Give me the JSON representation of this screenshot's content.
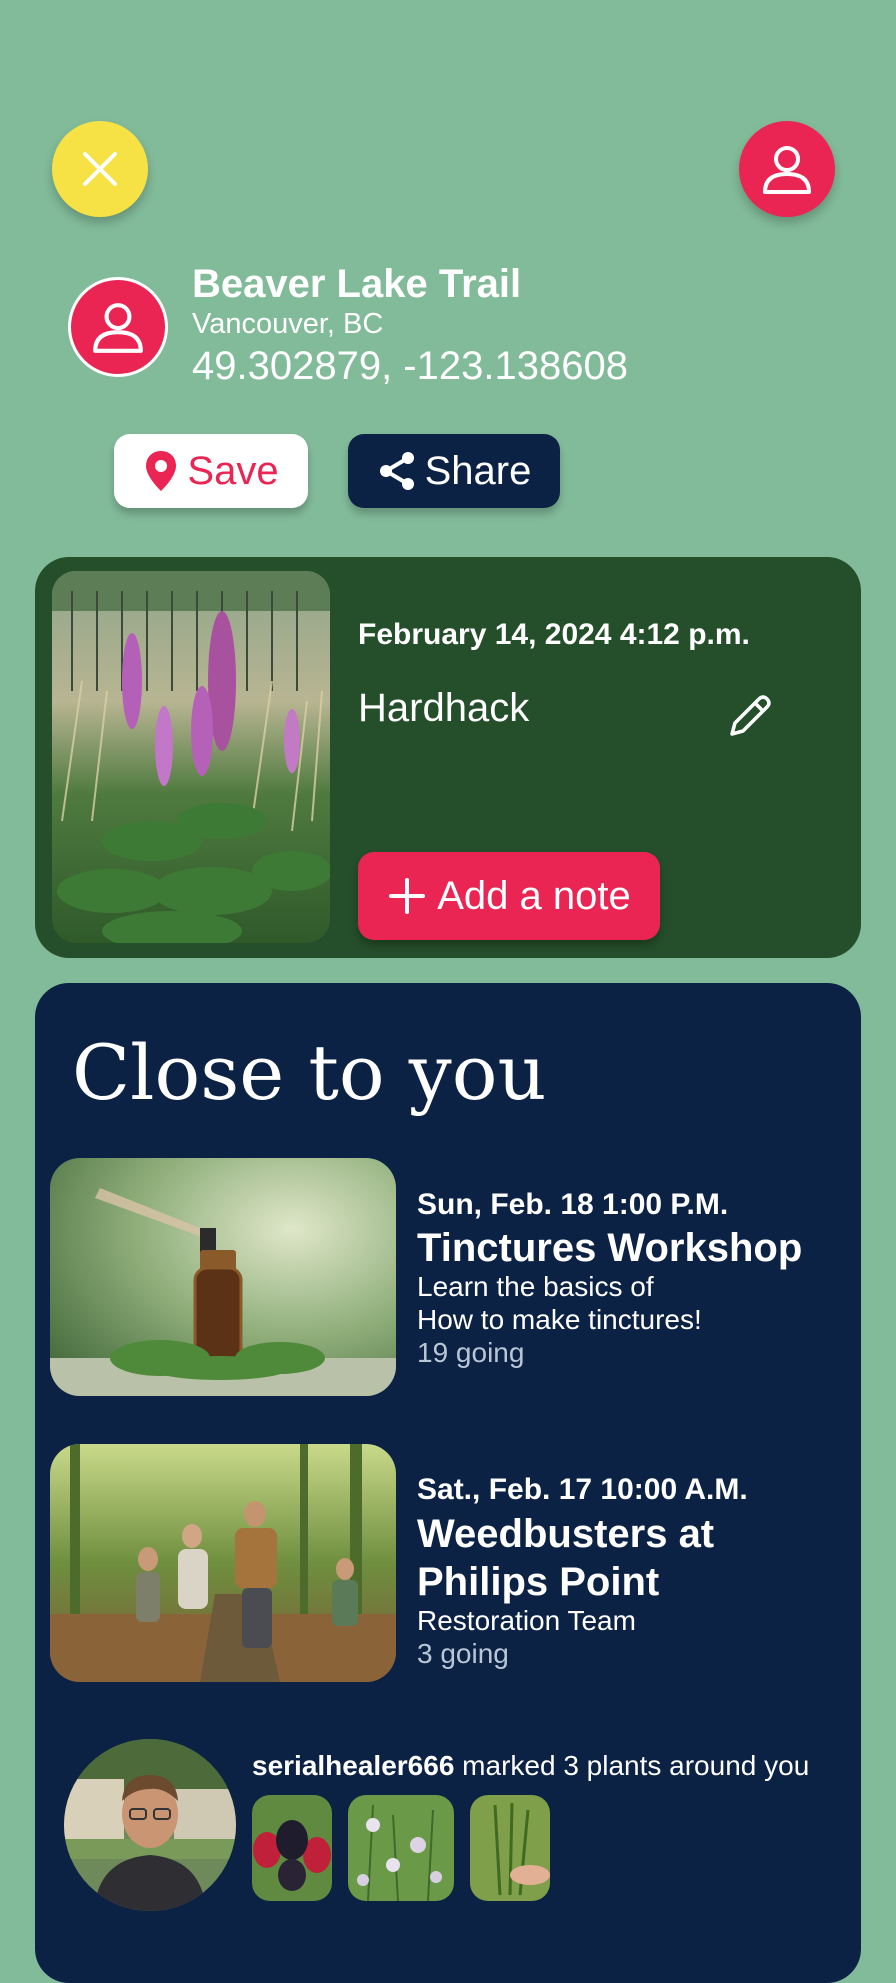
{
  "colors": {
    "background": "#82bb9a",
    "accent_red": "#ea2553",
    "accent_yellow": "#f6e245",
    "navy": "#0c2244",
    "forest": "#244f2a"
  },
  "header": {
    "close_icon": "close-icon",
    "profile_icon": "user-icon"
  },
  "location": {
    "avatar_icon": "user-icon",
    "title": "Beaver Lake Trail",
    "city": "Vancouver, BC",
    "coordinates": "49.302879, -123.138608"
  },
  "actions": {
    "save_label": "Save",
    "save_icon": "map-pin-icon",
    "share_label": "Share",
    "share_icon": "share-icon"
  },
  "observation": {
    "datetime": "February 14, 2024 4:12 p.m.",
    "plant": "Hardhack",
    "edit_icon": "pencil-icon",
    "add_note_label": "Add a note",
    "add_note_icon": "plus-icon"
  },
  "nearby": {
    "title": "Close to you",
    "events": [
      {
        "date": "Sun, Feb. 18 1:00 P.M.",
        "title": "Tinctures Workshop",
        "desc_line1": "Learn the basics of",
        "desc_line2": "How to make tinctures!",
        "going": "19 going"
      },
      {
        "date": "Sat., Feb. 17 10:00 A.M.",
        "title": "Weedbusters at Philips Point",
        "desc_line1": "Restoration Team",
        "going": "3 going"
      }
    ],
    "activity": {
      "username": "serialhealer666",
      "text": "marked 3 plants around you"
    }
  }
}
